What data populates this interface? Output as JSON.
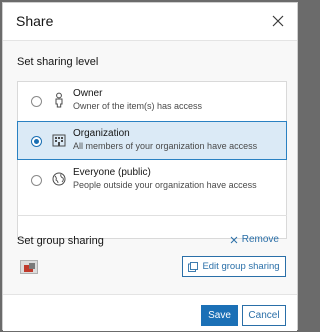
{
  "dialog": {
    "title": "Share",
    "close_icon": "close-icon"
  },
  "sharing_level": {
    "label": "Set sharing level",
    "options": [
      {
        "title": "Owner",
        "description": "Owner of the item(s) has access",
        "icon": "owner-person-icon",
        "selected": false
      },
      {
        "title": "Organization",
        "description": "All members of your organization have access",
        "icon": "organization-building-icon",
        "selected": true
      },
      {
        "title": "Everyone (public)",
        "description": "People outside your organization have access",
        "icon": "public-globe-icon",
        "selected": false
      }
    ]
  },
  "group_sharing": {
    "label": "Set group sharing",
    "remove_label": "Remove",
    "edit_label": "Edit group sharing",
    "group_thumbnail_icon": "group-thumbnail-icon"
  },
  "footer": {
    "save_label": "Save",
    "cancel_label": "Cancel"
  },
  "colors": {
    "accent": "#1b70b6",
    "selected_bg": "#dbeaf6",
    "link": "#2a6fa8"
  }
}
